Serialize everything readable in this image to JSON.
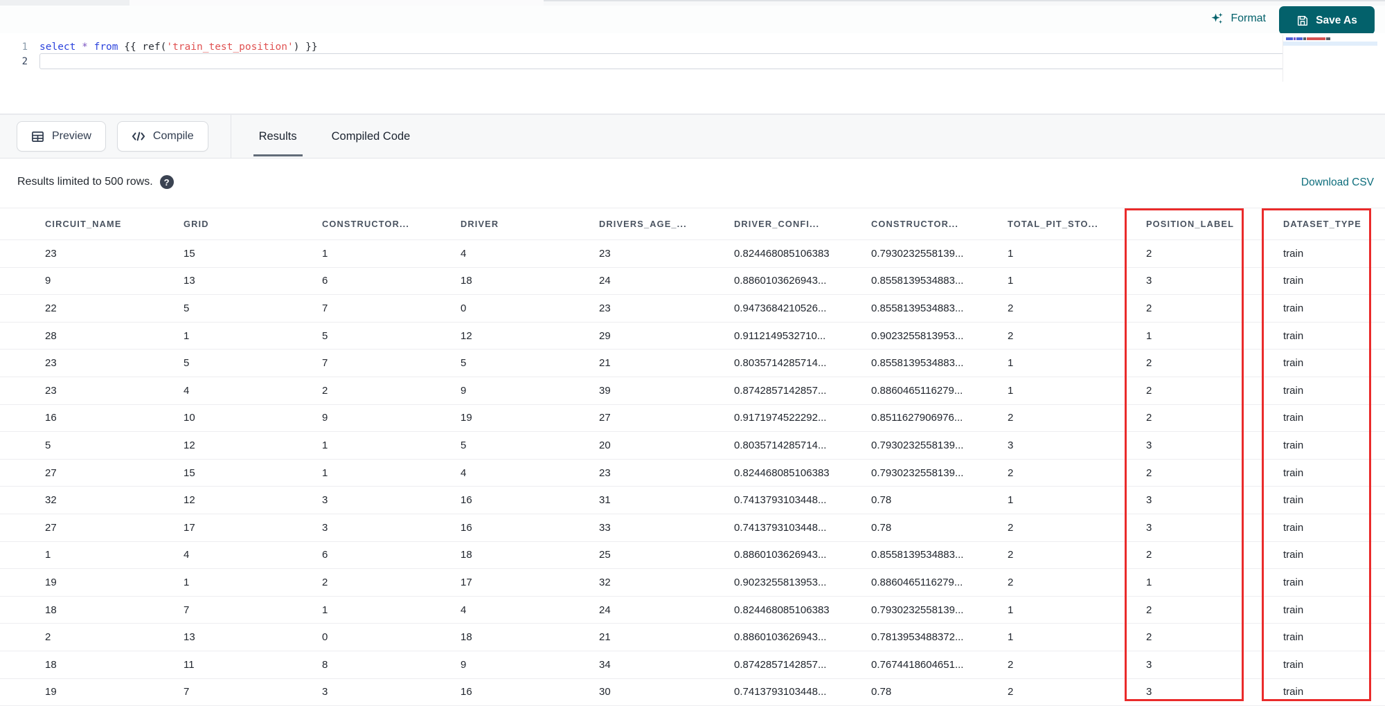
{
  "colors": {
    "accent": "#03616b",
    "link": "#0d6d7c",
    "highlight_red": "#ea2b2b",
    "code_keyword": "#2d44dd",
    "code_string": "#e05252",
    "code_operator": "#7e57c2"
  },
  "topbar": {
    "format_label": "Format",
    "save_as_label": "Save As"
  },
  "editor": {
    "lines": [
      {
        "number": "1",
        "active": false,
        "tokens": [
          {
            "text": "select",
            "type": "keyword"
          },
          {
            "text": " ",
            "type": "plain"
          },
          {
            "text": "*",
            "type": "operator"
          },
          {
            "text": " ",
            "type": "plain"
          },
          {
            "text": "from",
            "type": "keyword"
          },
          {
            "text": " {{ ref(",
            "type": "plain"
          },
          {
            "text": "'train_test_position'",
            "type": "string"
          },
          {
            "text": ") }}",
            "type": "plain"
          }
        ]
      },
      {
        "number": "2",
        "active": true,
        "tokens": []
      }
    ]
  },
  "toolbar": {
    "preview_label": "Preview",
    "compile_label": "Compile",
    "tabs": [
      {
        "label": "Results",
        "active": true
      },
      {
        "label": "Compiled Code",
        "active": false
      }
    ]
  },
  "results": {
    "limit_note": "Results limited to 500 rows.",
    "download_label": "Download CSV"
  },
  "table": {
    "headers": [
      "CIRCUIT_NAME",
      "GRID",
      "CONSTRUCTOR...",
      "DRIVER",
      "DRIVERS_AGE_...",
      "DRIVER_CONFI...",
      "CONSTRUCTOR...",
      "TOTAL_PIT_STO...",
      "POSITION_LABEL",
      "DATASET_TYPE"
    ],
    "highlighted_columns": [
      "POSITION_LABEL",
      "DATASET_TYPE"
    ],
    "rows": [
      [
        "23",
        "15",
        "1",
        "4",
        "23",
        "0.824468085106383",
        "0.7930232558139...",
        "1",
        "2",
        "train"
      ],
      [
        "9",
        "13",
        "6",
        "18",
        "24",
        "0.8860103626943...",
        "0.8558139534883...",
        "1",
        "3",
        "train"
      ],
      [
        "22",
        "5",
        "7",
        "0",
        "23",
        "0.9473684210526...",
        "0.8558139534883...",
        "2",
        "2",
        "train"
      ],
      [
        "28",
        "1",
        "5",
        "12",
        "29",
        "0.9112149532710...",
        "0.9023255813953...",
        "2",
        "1",
        "train"
      ],
      [
        "23",
        "5",
        "7",
        "5",
        "21",
        "0.8035714285714...",
        "0.8558139534883...",
        "1",
        "2",
        "train"
      ],
      [
        "23",
        "4",
        "2",
        "9",
        "39",
        "0.8742857142857...",
        "0.8860465116279...",
        "1",
        "2",
        "train"
      ],
      [
        "16",
        "10",
        "9",
        "19",
        "27",
        "0.9171974522292...",
        "0.8511627906976...",
        "2",
        "2",
        "train"
      ],
      [
        "5",
        "12",
        "1",
        "5",
        "20",
        "0.8035714285714...",
        "0.7930232558139...",
        "3",
        "3",
        "train"
      ],
      [
        "27",
        "15",
        "1",
        "4",
        "23",
        "0.824468085106383",
        "0.7930232558139...",
        "2",
        "2",
        "train"
      ],
      [
        "32",
        "12",
        "3",
        "16",
        "31",
        "0.7413793103448...",
        "0.78",
        "1",
        "3",
        "train"
      ],
      [
        "27",
        "17",
        "3",
        "16",
        "33",
        "0.7413793103448...",
        "0.78",
        "2",
        "3",
        "train"
      ],
      [
        "1",
        "4",
        "6",
        "18",
        "25",
        "0.8860103626943...",
        "0.8558139534883...",
        "2",
        "2",
        "train"
      ],
      [
        "19",
        "1",
        "2",
        "17",
        "32",
        "0.9023255813953...",
        "0.8860465116279...",
        "2",
        "1",
        "train"
      ],
      [
        "18",
        "7",
        "1",
        "4",
        "24",
        "0.824468085106383",
        "0.7930232558139...",
        "1",
        "2",
        "train"
      ],
      [
        "2",
        "13",
        "0",
        "18",
        "21",
        "0.8860103626943...",
        "0.7813953488372...",
        "1",
        "2",
        "train"
      ],
      [
        "18",
        "11",
        "8",
        "9",
        "34",
        "0.8742857142857...",
        "0.7674418604651...",
        "2",
        "3",
        "train"
      ],
      [
        "19",
        "7",
        "3",
        "16",
        "30",
        "0.7413793103448...",
        "0.78",
        "2",
        "3",
        "train"
      ]
    ]
  }
}
